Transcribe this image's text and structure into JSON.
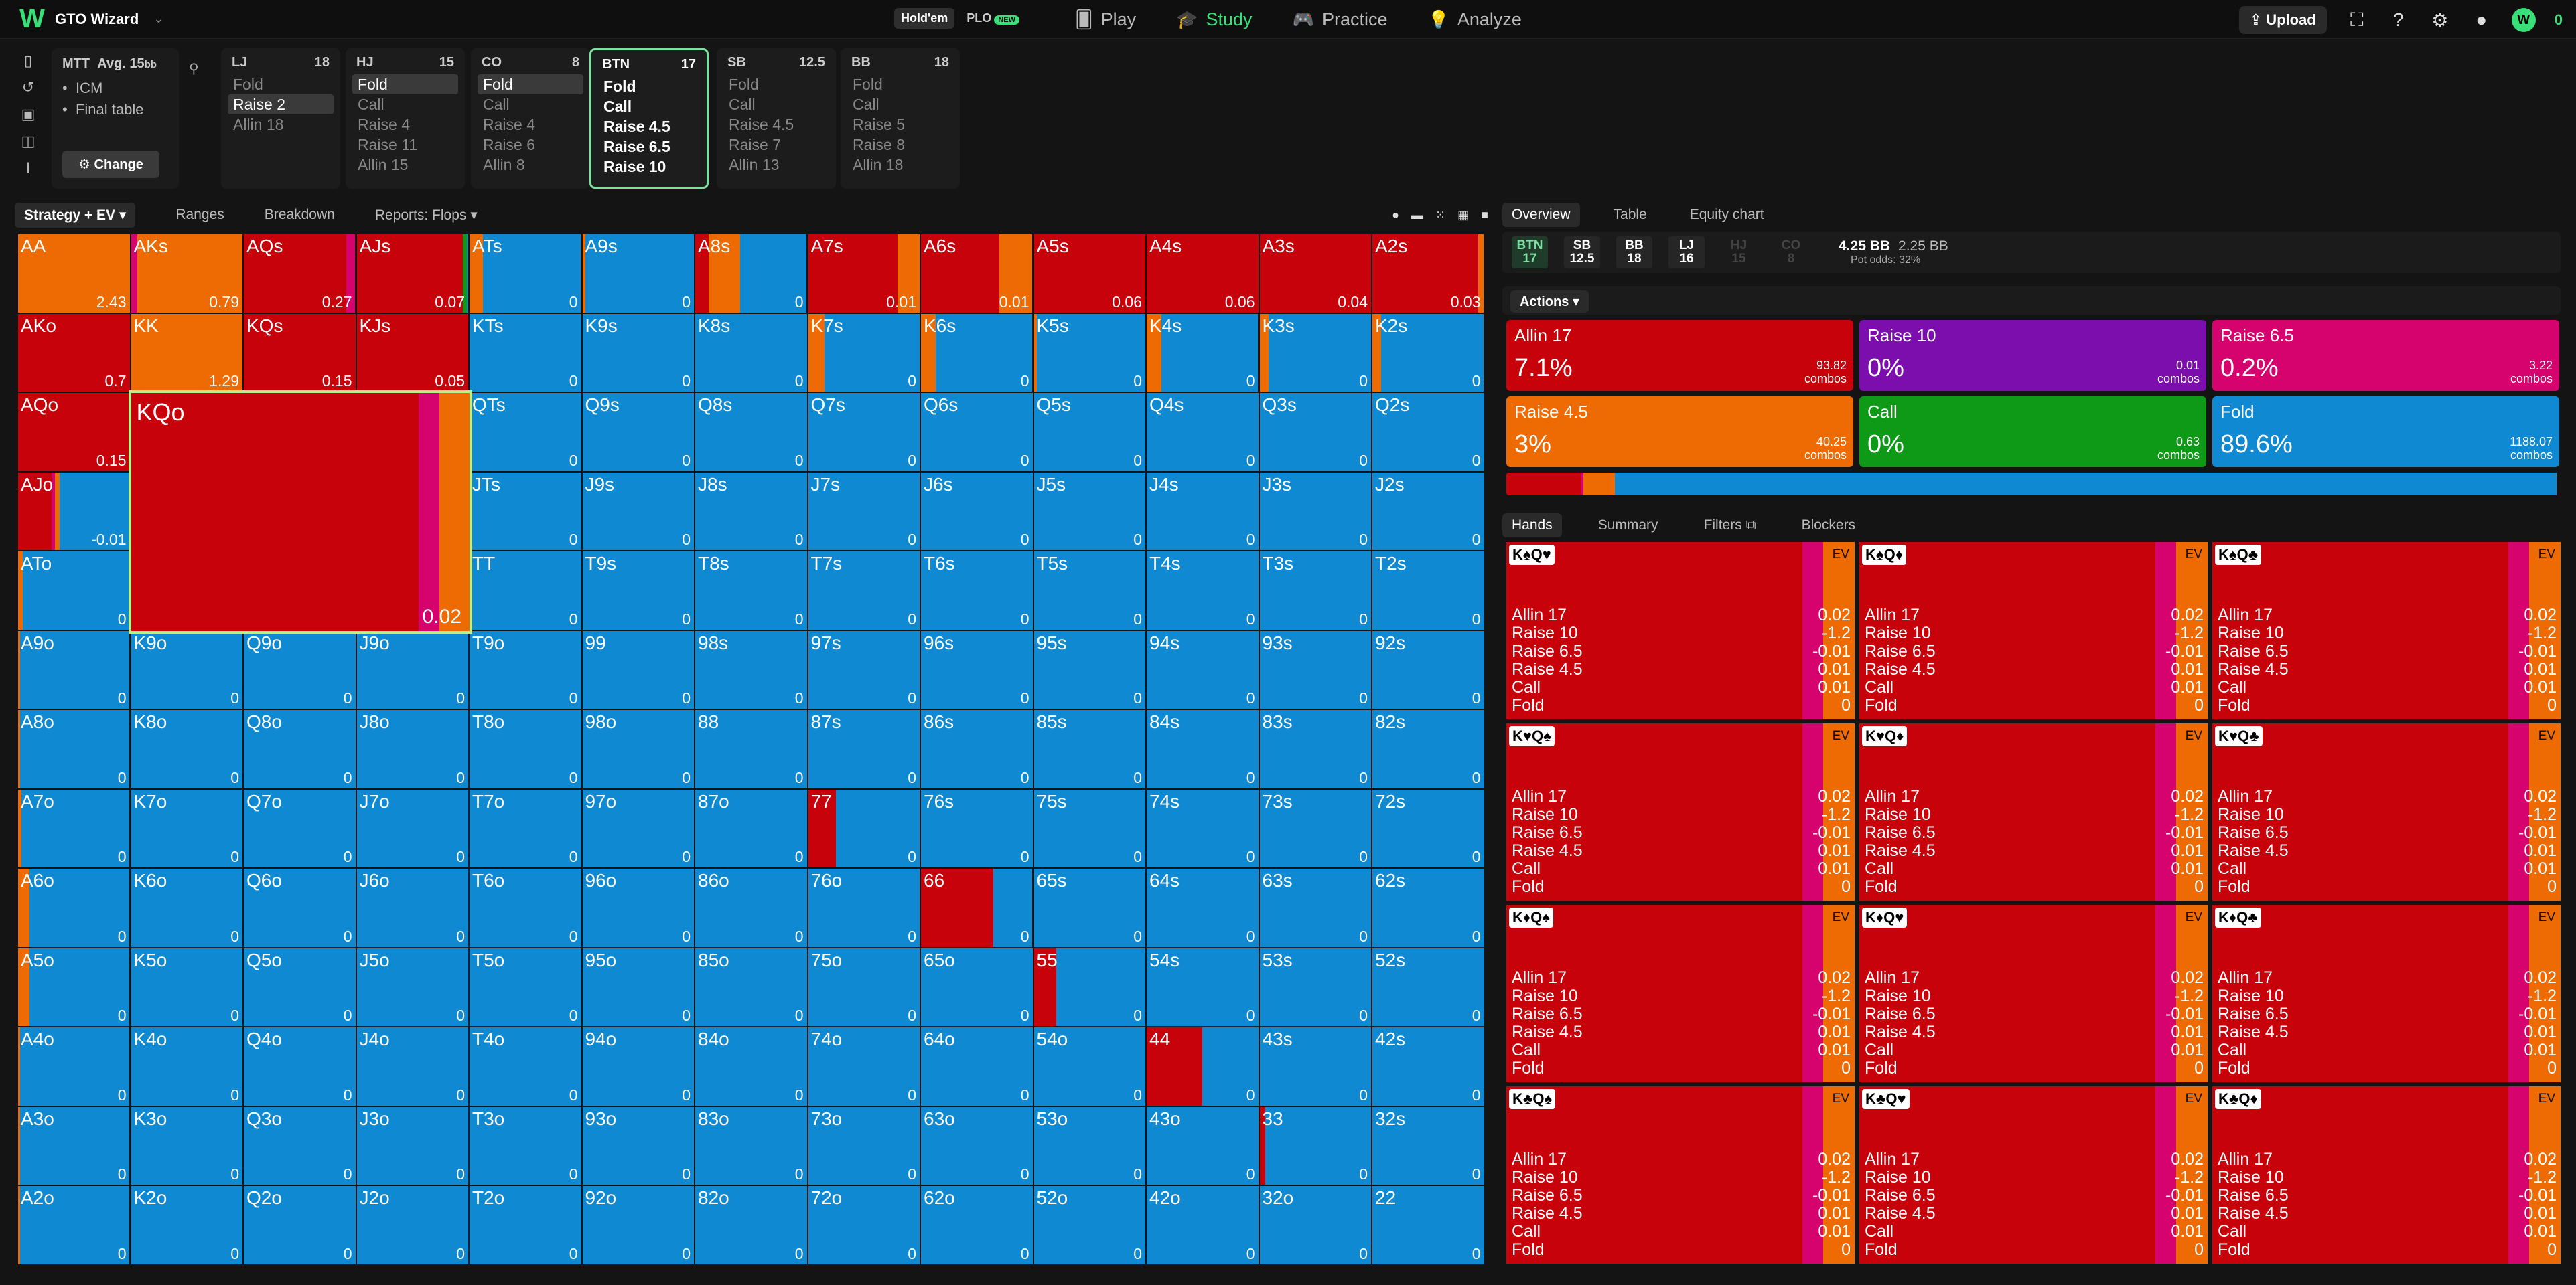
{
  "app": {
    "brand_name": "GTO Wizard",
    "game_modes": [
      "Hold'em",
      "PLO"
    ],
    "new_badge": "NEW",
    "nav": [
      "Play",
      "Study",
      "Practice",
      "Analyze"
    ],
    "upload_label": "Upload",
    "user_initial": "W",
    "credits": "0"
  },
  "scenario": {
    "format": "MTT",
    "avg_label": "Avg. 15",
    "avg_unit": "bb",
    "bullets": [
      "ICM",
      "Final table"
    ],
    "change_label": "Change",
    "positions": [
      {
        "pos": "LJ",
        "stack": "18",
        "actions": [
          "Fold",
          "Raise 2",
          "Allin 18"
        ],
        "selected": "Raise 2"
      },
      {
        "pos": "HJ",
        "stack": "15",
        "actions": [
          "Fold",
          "Call",
          "Raise 4",
          "Raise 11",
          "Allin 15"
        ],
        "selected": "Fold"
      },
      {
        "pos": "CO",
        "stack": "8",
        "actions": [
          "Fold",
          "Call",
          "Raise 4",
          "Raise 6",
          "Allin 8"
        ],
        "selected": "Fold"
      },
      {
        "pos": "BTN",
        "stack": "17",
        "actions": [
          "Fold",
          "Call",
          "Raise 4.5",
          "Raise 6.5",
          "Raise 10"
        ],
        "selected": "",
        "active": true
      },
      {
        "pos": "SB",
        "stack": "12.5",
        "actions": [
          "Fold",
          "Call",
          "Raise 4.5",
          "Raise 7",
          "Allin 13"
        ],
        "selected": ""
      },
      {
        "pos": "BB",
        "stack": "18",
        "actions": [
          "Fold",
          "Call",
          "Raise 5",
          "Raise 8",
          "Allin 18"
        ],
        "selected": ""
      }
    ]
  },
  "grid_toolbar": {
    "view": "Strategy + EV",
    "items": [
      "Ranges",
      "Breakdown",
      "Reports: Flops"
    ]
  },
  "colors": {
    "allin": "#c8020a",
    "raise10": "#7b0eac",
    "raise65": "#d6036e",
    "raise45": "#ee6a03",
    "call": "#0e9a16",
    "fold": "#0f8ad2"
  },
  "grid": {
    "ranks": [
      "A",
      "K",
      "Q",
      "J",
      "T",
      "9",
      "8",
      "7",
      "6",
      "5",
      "4",
      "3",
      "2"
    ],
    "ev": [
      [
        "2.43",
        "0.79",
        "0.27",
        "0.07",
        "0",
        "0",
        "0",
        "0.01",
        "0.01",
        "0.06",
        "0.06",
        "0.04",
        "0.03"
      ],
      [
        "0.7",
        "1.29",
        "0.15",
        "0.05",
        "0",
        "0",
        "0",
        "0",
        "0",
        "0",
        "0",
        "0",
        "0"
      ],
      [
        "0.15",
        "0.02",
        "0",
        "0",
        "0",
        "0",
        "0",
        "0",
        "0",
        "0",
        "0",
        "0",
        "0"
      ],
      [
        "-0.01",
        "0",
        "0",
        "0",
        "0",
        "0",
        "0",
        "0",
        "0",
        "0",
        "0",
        "0",
        "0"
      ],
      [
        "0",
        "0",
        "0",
        "0",
        "0",
        "0",
        "0",
        "0",
        "0",
        "0",
        "0",
        "0",
        "0"
      ],
      [
        "0",
        "0",
        "0",
        "0",
        "0",
        "0",
        "0",
        "0",
        "0",
        "0",
        "0",
        "0",
        "0"
      ],
      [
        "0",
        "0",
        "0",
        "0",
        "0",
        "0",
        "0",
        "0",
        "0",
        "0",
        "0",
        "0",
        "0"
      ],
      [
        "0",
        "0",
        "0",
        "0",
        "0",
        "0",
        "0",
        "0",
        "0",
        "0",
        "0",
        "0",
        "0"
      ],
      [
        "0",
        "0",
        "0",
        "0",
        "0",
        "0",
        "0",
        "0",
        "0",
        "0",
        "0",
        "0",
        "0"
      ],
      [
        "0",
        "0",
        "0",
        "0",
        "0",
        "0",
        "0",
        "0",
        "0",
        "0",
        "0",
        "0",
        "0"
      ],
      [
        "0",
        "0",
        "0",
        "0",
        "0",
        "0",
        "0",
        "0",
        "0",
        "0",
        "0",
        "0",
        "0"
      ],
      [
        "0",
        "0",
        "0",
        "0",
        "0",
        "0",
        "0",
        "0",
        "0",
        "0",
        "0",
        "0",
        "0"
      ],
      [
        "0",
        "0",
        "0",
        "0",
        "0",
        "0",
        "0",
        "0",
        "0",
        "0",
        "0",
        "0",
        "0"
      ]
    ],
    "special_mix": {
      "AA": [
        0,
        0,
        0,
        1,
        0,
        0
      ],
      "AKs": [
        0,
        0,
        0.06,
        0.94,
        0,
        0
      ],
      "AQs": [
        0.92,
        0,
        0.08,
        0,
        0,
        0
      ],
      "AJs": [
        0.95,
        0,
        0,
        0,
        0.04,
        0.01
      ],
      "ATs": [
        0,
        0,
        0,
        0.12,
        0,
        0.88
      ],
      "A9s": [
        0,
        0,
        0,
        0.03,
        0,
        0.97
      ],
      "A8s": [
        0.12,
        0,
        0,
        0.28,
        0,
        0.6
      ],
      "A7s": [
        0.8,
        0,
        0,
        0.2,
        0,
        0
      ],
      "A6s": [
        0.7,
        0,
        0,
        0.3,
        0,
        0
      ],
      "A5s": [
        1,
        0,
        0,
        0,
        0,
        0
      ],
      "A4s": [
        1,
        0,
        0,
        0,
        0,
        0
      ],
      "A3s": [
        1,
        0,
        0,
        0,
        0,
        0
      ],
      "A2s": [
        0.95,
        0,
        0,
        0.05,
        0,
        0
      ],
      "AKo": [
        1,
        0,
        0,
        0,
        0,
        0
      ],
      "KK": [
        0,
        0,
        0,
        1,
        0,
        0
      ],
      "KQs": [
        1,
        0,
        0,
        0,
        0,
        0
      ],
      "KJs": [
        1,
        0,
        0,
        0,
        0,
        0
      ],
      "K7s": [
        0,
        0,
        0,
        0.15,
        0,
        0.85
      ],
      "K6s": [
        0,
        0,
        0,
        0.13,
        0,
        0.87
      ],
      "K5s": [
        0,
        0,
        0,
        0.03,
        0,
        0.97
      ],
      "K4s": [
        0,
        0,
        0,
        0.13,
        0,
        0.87
      ],
      "K3s": [
        0,
        0,
        0,
        0.08,
        0,
        0.92
      ],
      "K2s": [
        0,
        0,
        0,
        0.08,
        0,
        0.92
      ],
      "AQo": [
        1,
        0,
        0,
        0,
        0,
        0
      ],
      "KQo": [
        0.85,
        0,
        0.06,
        0.09,
        0,
        0
      ],
      "AJo": [
        0.3,
        0,
        0.03,
        0.04,
        0,
        0.63
      ],
      "ATo": [
        0,
        0,
        0,
        0.04,
        0,
        0.96
      ],
      "A9o": [
        0,
        0,
        0,
        0.02,
        0,
        0.98
      ],
      "A8o": [
        0,
        0,
        0,
        0.02,
        0,
        0.98
      ],
      "A7o": [
        0,
        0,
        0,
        0.03,
        0,
        0.97
      ],
      "A6o": [
        0,
        0,
        0,
        0.1,
        0,
        0.9
      ],
      "A5o": [
        0,
        0,
        0,
        0.1,
        0,
        0.9
      ],
      "A4o": [
        0,
        0,
        0,
        0.02,
        0,
        0.98
      ],
      "A3o": [
        0,
        0,
        0,
        0.02,
        0,
        0.98
      ],
      "A2o": [
        0,
        0,
        0,
        0.02,
        0,
        0.98
      ],
      "77": [
        0.25,
        0,
        0,
        0,
        0,
        0.75
      ],
      "66": [
        0.65,
        0,
        0,
        0,
        0,
        0.35
      ],
      "55": [
        0.2,
        0,
        0,
        0,
        0,
        0.8
      ],
      "44": [
        0.5,
        0,
        0,
        0,
        0,
        0.5
      ],
      "33": [
        0.05,
        0,
        0,
        0,
        0,
        0.95
      ]
    }
  },
  "right_panel": {
    "tabs": [
      "Overview",
      "Table",
      "Equity chart"
    ],
    "stacks": [
      {
        "pos": "BTN",
        "val": "17"
      },
      {
        "pos": "SB",
        "val": "12.5"
      },
      {
        "pos": "BB",
        "val": "18"
      },
      {
        "pos": "LJ",
        "val": "16"
      },
      {
        "pos": "HJ",
        "val": "15"
      },
      {
        "pos": "CO",
        "val": "8"
      }
    ],
    "pot": "4.25 BB",
    "pot2": "2.25 BB",
    "pot_odds_label": "Pot odds:",
    "pot_odds": "32%",
    "actions_label": "Actions",
    "action_cards": [
      {
        "name": "Allin 17",
        "pct": "7.1%",
        "combos": "93.82",
        "color": "#c8020a"
      },
      {
        "name": "Raise 10",
        "pct": "0%",
        "combos": "0.01",
        "color": "#7b0eac"
      },
      {
        "name": "Raise 6.5",
        "pct": "0.2%",
        "combos": "3.22",
        "color": "#d6036e"
      },
      {
        "name": "Raise 4.5",
        "pct": "3%",
        "combos": "40.25",
        "color": "#ee6a03"
      },
      {
        "name": "Call",
        "pct": "0%",
        "combos": "0.63",
        "color": "#0e9a16"
      },
      {
        "name": "Fold",
        "pct": "89.6%",
        "combos": "1188.07",
        "color": "#0f8ad2"
      }
    ],
    "combos_unit": "combos",
    "freq_bar": [
      0.071,
      0,
      0.002,
      0.03,
      0,
      0.896
    ],
    "hands_tabs": [
      "Hands",
      "Summary",
      "Filters",
      "Blockers"
    ],
    "ev_label": "EV",
    "combos": [
      {
        "cards": "K♠Q♥"
      },
      {
        "cards": "K♠Q♦"
      },
      {
        "cards": "K♠Q♣"
      },
      {
        "cards": "K♥Q♠"
      },
      {
        "cards": "K♥Q♦"
      },
      {
        "cards": "K♥Q♣"
      },
      {
        "cards": "K♦Q♠"
      },
      {
        "cards": "K♦Q♥"
      },
      {
        "cards": "K♦Q♣"
      },
      {
        "cards": "K♣Q♠"
      },
      {
        "cards": "K♣Q♥"
      },
      {
        "cards": "K♣Q♦"
      }
    ],
    "combo_rows": [
      {
        "name": "Allin 17",
        "ev": "0.02"
      },
      {
        "name": "Raise 10",
        "ev": "-1.2"
      },
      {
        "name": "Raise 6.5",
        "ev": "-0.01"
      },
      {
        "name": "Raise 4.5",
        "ev": "0.01"
      },
      {
        "name": "Call",
        "ev": "0.01"
      },
      {
        "name": "Fold",
        "ev": "0"
      }
    ]
  }
}
